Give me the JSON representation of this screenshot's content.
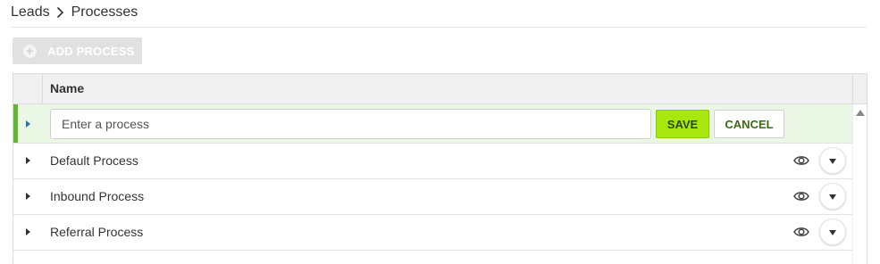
{
  "breadcrumb": {
    "items": [
      "Leads",
      "Processes"
    ],
    "separator_icon": "chevron-right-icon"
  },
  "toolbar": {
    "add_process_label": "ADD PROCESS",
    "add_icon": "plus-circle-icon"
  },
  "grid": {
    "columns": [
      "Name"
    ],
    "edit_row": {
      "input_value": "",
      "input_placeholder": "Enter a process",
      "save_label": "SAVE",
      "cancel_label": "CANCEL"
    },
    "rows": [
      {
        "name": "Default Process"
      },
      {
        "name": "Inbound Process"
      },
      {
        "name": "Referral Process"
      }
    ],
    "row_icons": [
      "eye-icon",
      "caret-down-icon"
    ]
  },
  "colors": {
    "accent_green": "#5cb82e",
    "save_button": "#a8e80f",
    "edit_row_background": "#eaf7e4",
    "disabled_button": "#e1e1e1"
  }
}
